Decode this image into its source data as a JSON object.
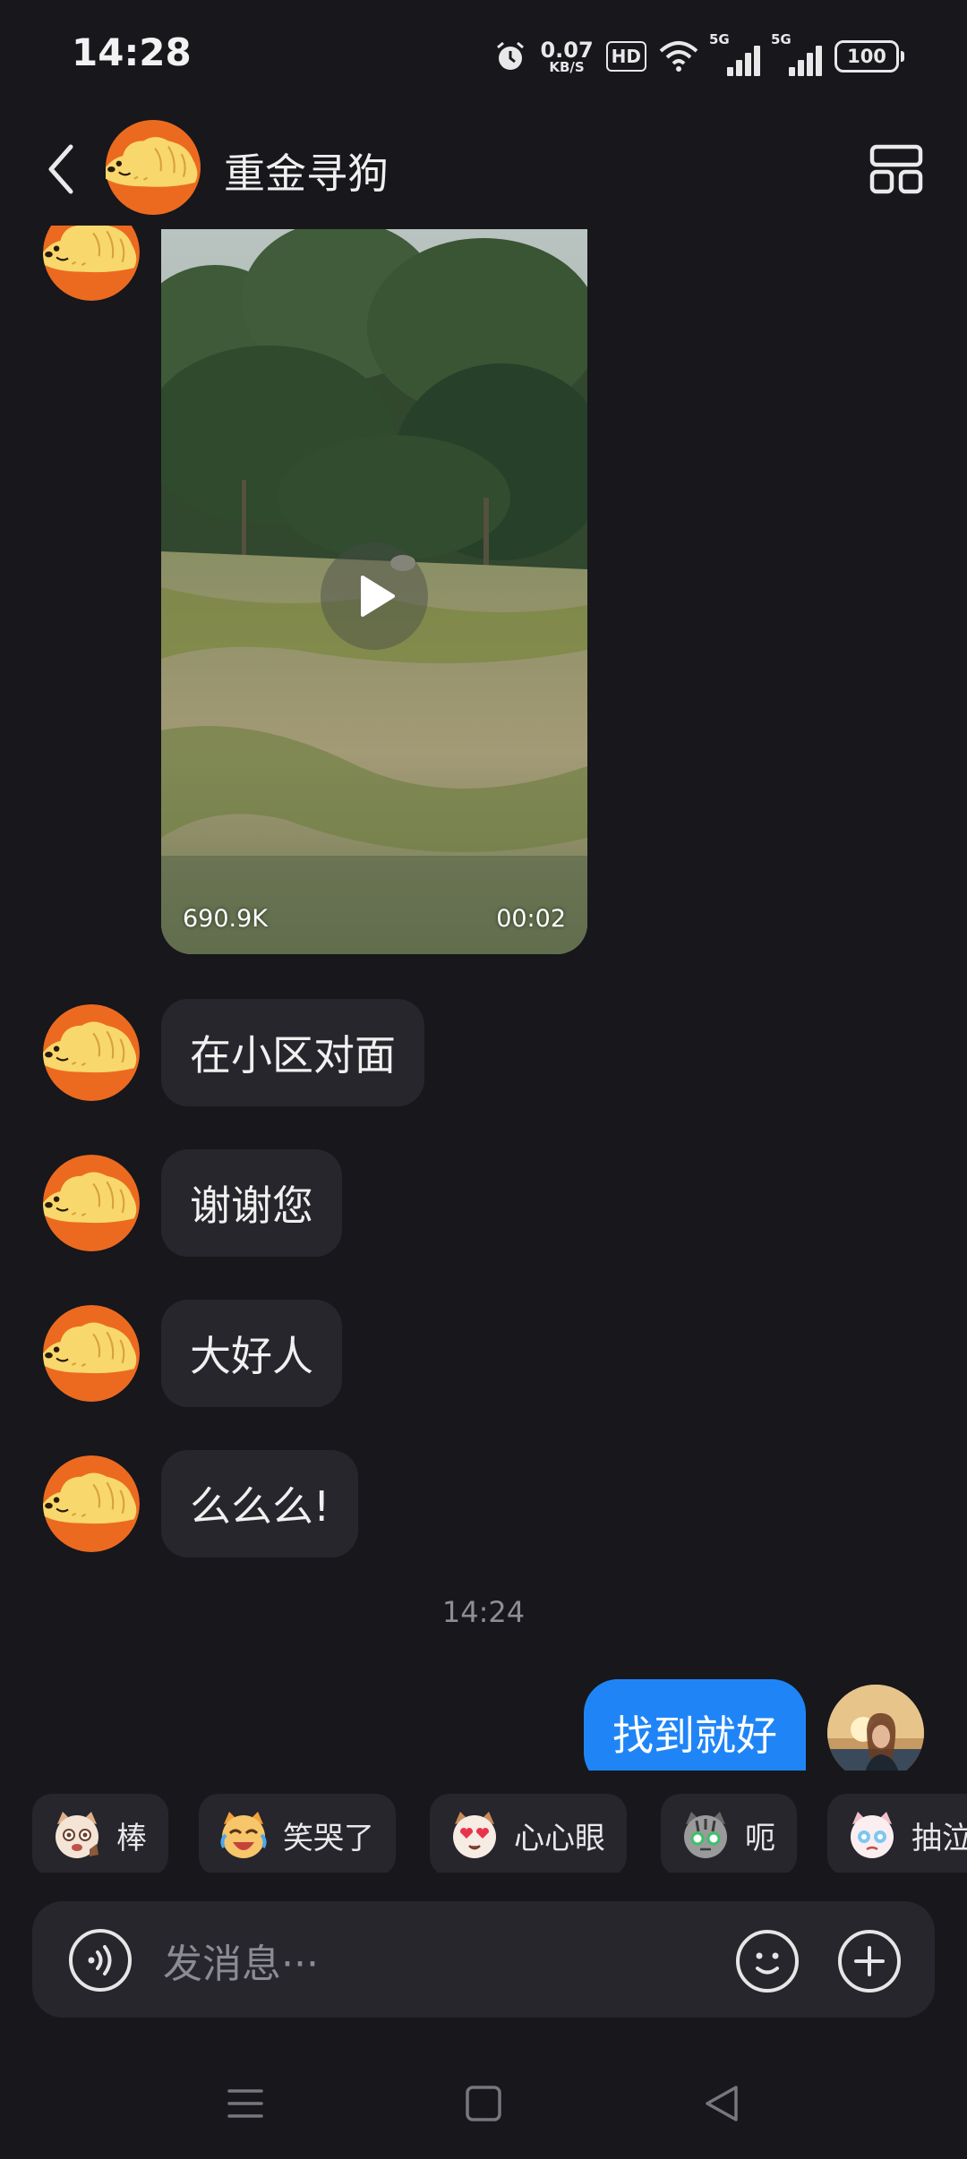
{
  "status_bar": {
    "time": "14:28",
    "net_speed_value": "0.07",
    "net_speed_unit": "KB/S",
    "hd_label": "HD",
    "signal1_label": "5G",
    "signal2_label": "5G",
    "battery": "100",
    "icons": [
      "alarm-icon",
      "hd-voice-icon",
      "wifi-icon",
      "signal-5g-icon",
      "signal-5g-icon",
      "battery-icon"
    ]
  },
  "header": {
    "title": "重金寻狗",
    "icons": [
      "back-arrow-icon",
      "dog-avatar",
      "more-grid-icon"
    ]
  },
  "video_message": {
    "size_label": "690.9K",
    "duration": "00:02",
    "icon": "play-icon"
  },
  "messages": [
    {
      "text": "在小区对面",
      "sender": "other"
    },
    {
      "text": "谢谢您",
      "sender": "other"
    },
    {
      "text": "大好人",
      "sender": "other"
    },
    {
      "text": "么么么!",
      "sender": "other"
    }
  ],
  "timestamp": "14:24",
  "outgoing_message": {
    "text": "找到就好",
    "sender": "self"
  },
  "stickers": [
    {
      "label": "棒",
      "icon": "cat-thumbs-up-sticker"
    },
    {
      "label": "笑哭了",
      "icon": "cat-laughing-crying-sticker"
    },
    {
      "label": "心心眼",
      "icon": "cat-heart-eyes-sticker"
    },
    {
      "label": "呃",
      "icon": "cat-awkward-sticker"
    },
    {
      "label": "抽泣",
      "icon": "cat-sobbing-sticker"
    }
  ],
  "input": {
    "placeholder": "发消息···",
    "icons": [
      "voice-icon",
      "emoji-icon",
      "plus-icon"
    ]
  },
  "nav_bar": {
    "icons": [
      "menu-icon",
      "home-icon",
      "back-icon"
    ]
  },
  "colors": {
    "background": "#17171c",
    "bubble_incoming": "#26262c",
    "bubble_outgoing": "#1f85f7",
    "avatar_orange": "#ec6a1f",
    "avatar_dog_yellow": "#f8d86c"
  }
}
